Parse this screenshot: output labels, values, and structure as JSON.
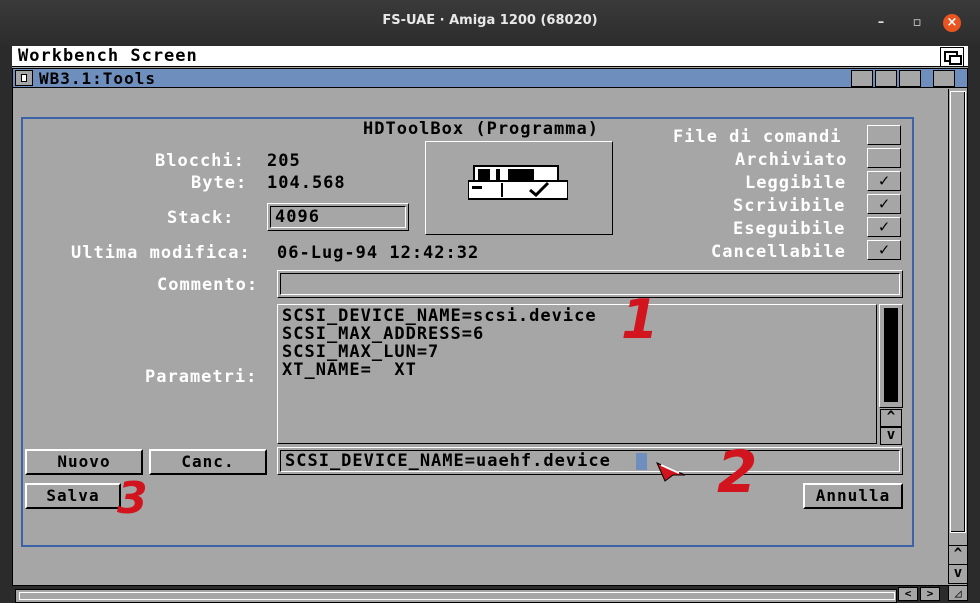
{
  "host": {
    "title": "FS-UAE · Amiga 1200 (68020)"
  },
  "screen": {
    "title": "Workbench Screen"
  },
  "window": {
    "title": "WB3.1:Tools"
  },
  "dialog": {
    "title": "HDToolBox (Programma)",
    "blocks_label": "Blocchi:",
    "blocks_value": "205",
    "bytes_label": "Byte:",
    "bytes_value": "104.568",
    "stack_label": "Stack:",
    "stack_value": "4096",
    "modified_label": "Ultima modifica:",
    "modified_value": "06-Lug-94 12:42:32",
    "comment_label": "Commento:",
    "comment_value": "",
    "params_label": "Parametri:",
    "params": [
      "SCSI_DEVICE_NAME=scsi.device",
      "SCSI_MAX_ADDRESS=6",
      "SCSI_MAX_LUN=7",
      "XT_NAME=  XT"
    ],
    "edit_value": "SCSI_DEVICE_NAME=uaehf.device",
    "flags": [
      {
        "label": "File di comandi",
        "checked": false
      },
      {
        "label": "Archiviato",
        "checked": false
      },
      {
        "label": "Leggibile",
        "checked": true
      },
      {
        "label": "Scrivibile",
        "checked": true
      },
      {
        "label": "Eseguibile",
        "checked": true
      },
      {
        "label": "Cancellabile",
        "checked": true
      }
    ],
    "buttons": {
      "new": "Nuovo",
      "delete": "Canc.",
      "save": "Salva",
      "cancel": "Annulla"
    }
  },
  "annotations": {
    "one": "1",
    "two": "2",
    "three": "3"
  },
  "icons": [
    "window-close-icon",
    "depth-gadget-icon",
    "zoom-gadget-icon",
    "hdtoolbox-drawer-icon",
    "mouse-pointer-icon",
    "checkmark-icon",
    "arrow-up-icon",
    "arrow-down-icon",
    "arrow-left-icon",
    "arrow-right-icon",
    "resize-icon"
  ],
  "colors": {
    "amiga_gray": "#a6a6a6",
    "amiga_blue": "#6e8fbd",
    "annotation_red": "#d2141e",
    "ubuntu_orange": "#e95420"
  }
}
